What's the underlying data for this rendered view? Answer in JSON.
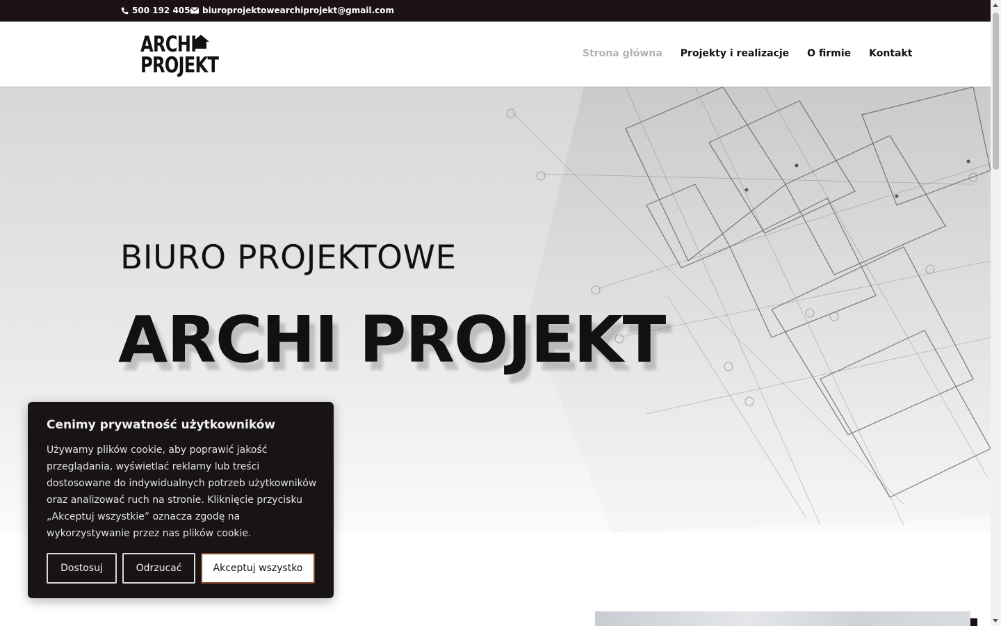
{
  "topbar": {
    "phone": "500 192 405",
    "email": "biuroprojektowearchiprojekt@gmail.com"
  },
  "logo": {
    "line1": "ARCHI",
    "line2": "PROJEKT"
  },
  "nav": {
    "items": [
      {
        "label": "Strona główna",
        "active": true
      },
      {
        "label": "Projekty i realizacje",
        "active": false
      },
      {
        "label": "O firmie",
        "active": false
      },
      {
        "label": "Kontakt",
        "active": false
      }
    ]
  },
  "hero": {
    "subtitle": "BIURO PROJEKTOWE",
    "title": "ARCHI PROJEKT"
  },
  "cookie": {
    "title": "Cenimy prywatność użytkowników",
    "text": "Używamy plików cookie, aby poprawić jakość przeglądania, wyświetlać reklamy lub treści dostosowane do indywidualnych potrzeb użytkowników oraz analizować ruch na stronie. Kliknięcie przycisku „Akceptuj wszystkie” oznacza zgodę na wykorzystywanie przez nas plików cookie.",
    "customize_label": "Dostosuj",
    "reject_label": "Odrzucać",
    "accept_label": "Akceptuj wszystko"
  },
  "colors": {
    "topbar_bg": "#1b1116",
    "nav_active": "#b1b1b7",
    "accept_border": "#8a4b2c"
  }
}
